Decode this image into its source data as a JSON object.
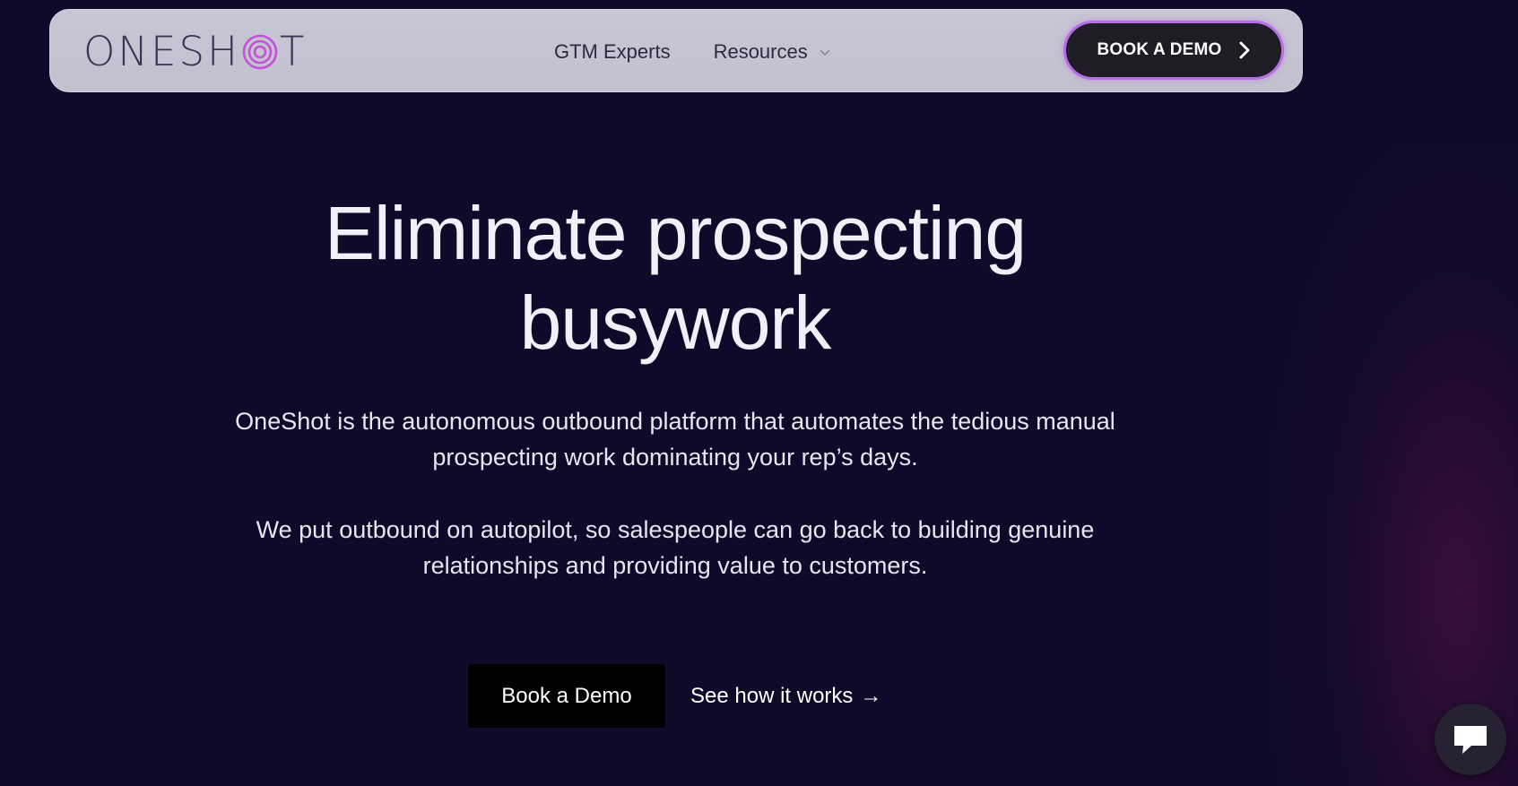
{
  "nav": {
    "logo_left": "ONESH",
    "logo_right": "T",
    "links": [
      {
        "label": "GTM Experts"
      },
      {
        "label": "Resources"
      }
    ],
    "cta_label": "BOOK A DEMO"
  },
  "hero": {
    "title_line1": "Eliminate prospecting",
    "title_line2": "busywork",
    "paragraph1_line1": "OneShot is the autonomous outbound platform that automates the tedious manual",
    "paragraph1_line2": "prospecting work dominating your rep’s days.",
    "paragraph2_line1": "We put outbound on autopilot, so salespeople can go back to building genuine",
    "paragraph2_line2": "relationships and providing value to customers.",
    "primary_cta": "Book a Demo",
    "secondary_cta": "See how it works",
    "secondary_arrow": "→"
  },
  "colors": {
    "background": "#0f0a2a",
    "navbar": "#c6c4d2",
    "accent_purple": "#b56ee6",
    "logo_ring": "#c451d6"
  },
  "icons": {
    "resources_chevron": "chevron-down-icon",
    "cta_chevron": "chevron-right-icon",
    "chat": "chat-bubble-icon"
  }
}
